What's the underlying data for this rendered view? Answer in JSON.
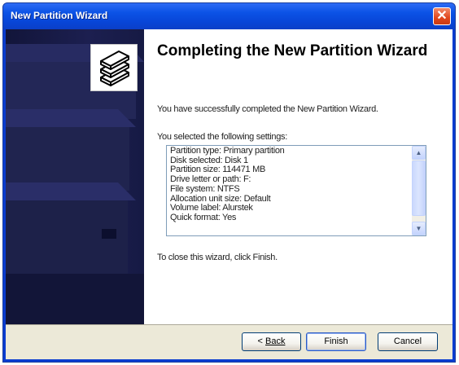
{
  "window": {
    "title": "New Partition Wizard",
    "close_symbol": "✕"
  },
  "left_panel": {
    "icon": "wizard-disk-stack-icon",
    "background_color": "#1a1d4a"
  },
  "content": {
    "heading": "Completing the New Partition Wizard",
    "description": "You have successfully completed the New Partition Wizard.",
    "settings_label": "You selected the following settings:",
    "settings": [
      "Partition type: Primary partition",
      "Disk selected: Disk 1",
      "Partition size: 114471 MB",
      "Drive letter or path: F:",
      "File system: NTFS",
      "Allocation unit size: Default",
      "Volume label: Alurstek",
      "Quick format: Yes"
    ],
    "close_instruction": "To close this wizard, click Finish."
  },
  "buttons": {
    "back_prefix": "< ",
    "back_label": "Back",
    "finish_label": "Finish",
    "cancel_label": "Cancel"
  },
  "colors": {
    "titlebar": "#0c53e6",
    "close_button": "#e0461c",
    "footer": "#ece9d8"
  }
}
